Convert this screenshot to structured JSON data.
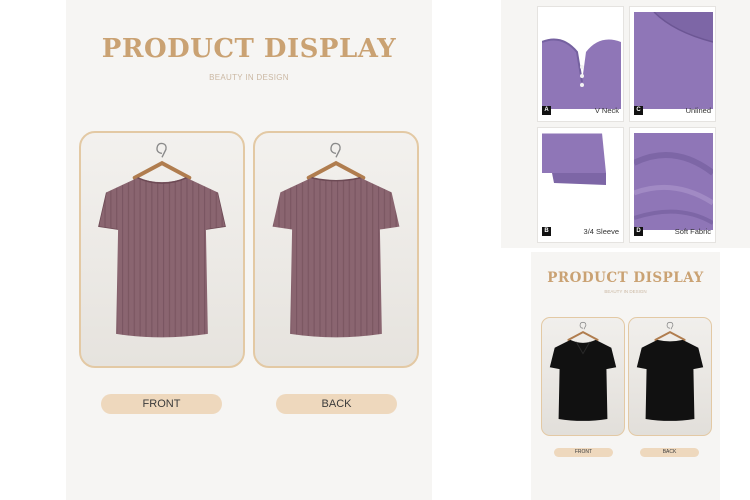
{
  "main": {
    "title": "PRODUCT DISPLAY",
    "subtitle": "BEAUTY IN DESIGN",
    "front_label": "FRONT",
    "back_label": "BACK",
    "shirt_color": "#8a6570",
    "accent_color": "#caa273"
  },
  "details": {
    "tiles": [
      {
        "badge": "A",
        "caption": "V Neck"
      },
      {
        "badge": "C",
        "caption": "Unlined"
      },
      {
        "badge": "B",
        "caption": "3/4 Sleeve"
      },
      {
        "badge": "D",
        "caption": "Soft Fabric"
      }
    ],
    "fabric_color": "#8f76b7"
  },
  "small": {
    "title": "PRODUCT DISPLAY",
    "subtitle": "BEAUTY IN DESIGN",
    "front_label": "FRONT",
    "back_label": "BACK",
    "shirt_color": "#111111"
  }
}
